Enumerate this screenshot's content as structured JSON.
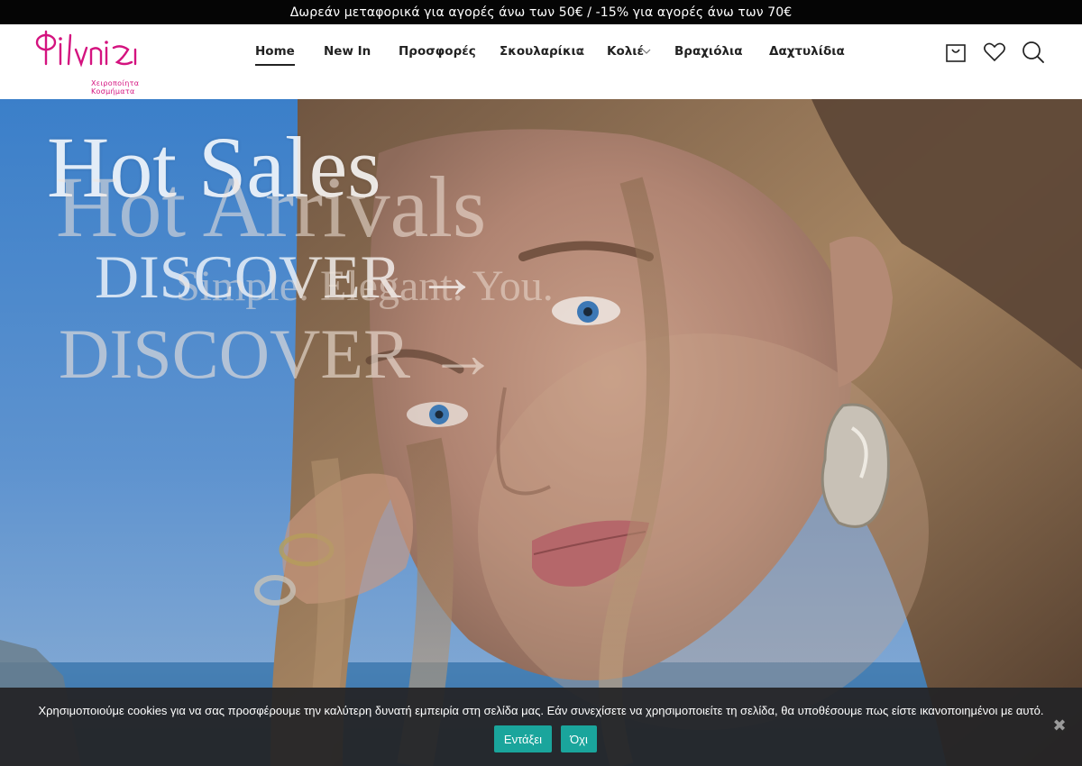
{
  "topbar": {
    "text": "Δωρεάν μεταφορικά για αγορές άνω των 50€ / -15% για αγορές άνω των 70€"
  },
  "header": {
    "logo_text": "Φίλντισι",
    "logo_tagline": "Χειροποίητα Κοσμήματα",
    "brand_color": "#d4137f",
    "nav": [
      {
        "label": "Home",
        "active": true
      },
      {
        "label": "New In"
      },
      {
        "label": "Προσφορές"
      },
      {
        "label": "Σκουλαρίκια",
        "dropdown": true
      },
      {
        "label": "Κολιέ",
        "dropdown": true
      },
      {
        "label": "Βραχιόλια"
      },
      {
        "label": "Δαχτυλίδια"
      }
    ],
    "icons": [
      "cart-icon",
      "heart-icon",
      "search-icon"
    ]
  },
  "hero": {
    "slide_a": {
      "title": "Hot Sales",
      "cta": "DISCOVER →"
    },
    "slide_b": {
      "title": "Hot Arrivals",
      "subtitle": "Simple. Elegant. You.",
      "cta": "DISCOVER →"
    }
  },
  "cookie": {
    "message": "Χρησιμοποιούμε cookies για να σας προσφέρουμε την καλύτερη δυνατή εμπειρία στη σελίδα μας. Εάν συνεχίσετε να χρησιμοποιείτε τη σελίδα, θα υποθέσουμε πως είστε ικανοποιημένοι με αυτό.",
    "accept_label": "Εντάξει",
    "decline_label": "Όχι",
    "close_label": "✖",
    "button_color": "#1aa59c"
  }
}
